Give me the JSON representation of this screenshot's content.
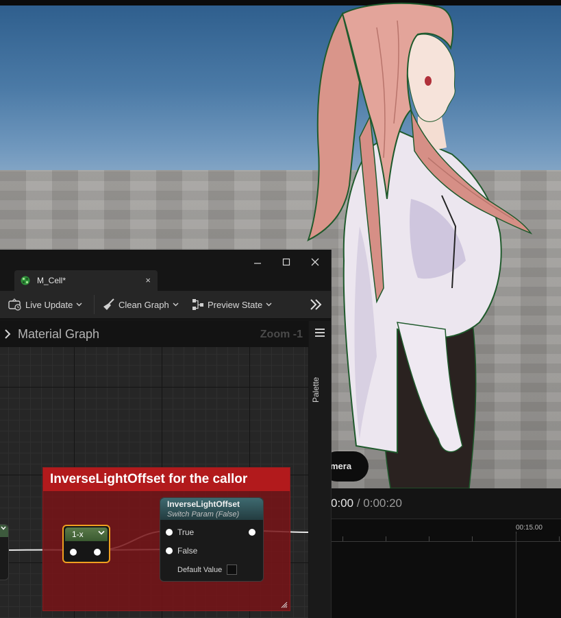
{
  "viewport": {
    "camera_button_label": "mera"
  },
  "sequencer": {
    "current_time": "0:00",
    "separator": "/",
    "total_time": "0:00:20",
    "ruler_label": "00:15.00"
  },
  "editor": {
    "window_controls": [
      "minimize",
      "maximize",
      "close"
    ],
    "tab": {
      "label": "M_Cell*",
      "icon": "material-icon",
      "close_label": "×"
    },
    "toolbar": {
      "live_update_label": "Live Update",
      "clean_graph_label": "Clean Graph",
      "preview_state_label": "Preview State",
      "more_icon": "double-chevron-right-icon"
    },
    "graph_header": {
      "title": "Material Graph",
      "zoom": "Zoom -1"
    },
    "palette": {
      "label": "Palette"
    },
    "comment": {
      "title": "InverseLightOffset for the callor"
    },
    "one_minus_node": {
      "label": "1-x"
    },
    "switch_node": {
      "title": "InverseLightOffset",
      "subtitle": "Switch Param (False)",
      "pins": [
        "True",
        "False"
      ],
      "default_value_label": "Default Value",
      "default_value": false
    }
  },
  "colors": {
    "comment_title": "#b21a1c",
    "comment_body": "#7a1418",
    "selected_outline": "#f0a020",
    "switch_header": "#3e6a70",
    "graph_bg": "#262626"
  }
}
